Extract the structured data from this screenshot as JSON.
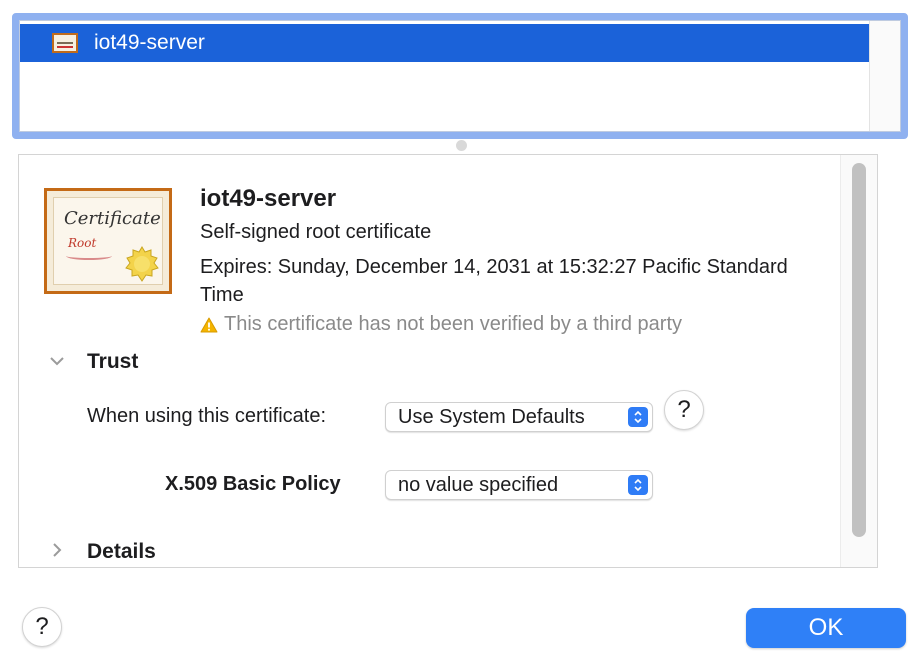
{
  "certificate_list": {
    "items": [
      {
        "label": "iot49-server",
        "icon": "certificate-icon",
        "selected": true
      }
    ]
  },
  "details": {
    "icon": "certificate-icon",
    "icon_title": "Certificate",
    "icon_subtitle": "Root",
    "name": "iot49-server",
    "kind": "Self-signed root certificate",
    "expires": "Expires: Sunday, December 14, 2031 at 15:32:27 Pacific Standard Time",
    "warning": "This certificate has not been verified by a third party",
    "warning_icon": "warning-triangle-icon"
  },
  "trust": {
    "header": "Trust",
    "expanded": true,
    "when_using_label": "When using this certificate:",
    "when_using_value": "Use System Defaults",
    "help_label": "?",
    "x509_label": "X.509 Basic Policy",
    "x509_value": "no value specified"
  },
  "details_section": {
    "header": "Details",
    "expanded": false
  },
  "footer": {
    "help_label": "?",
    "ok_label": "OK"
  },
  "colors": {
    "selection": "#1b62d9",
    "focus_ring": "#8fb1f0",
    "accent": "#2f80f7",
    "warning": "#f4b400"
  }
}
